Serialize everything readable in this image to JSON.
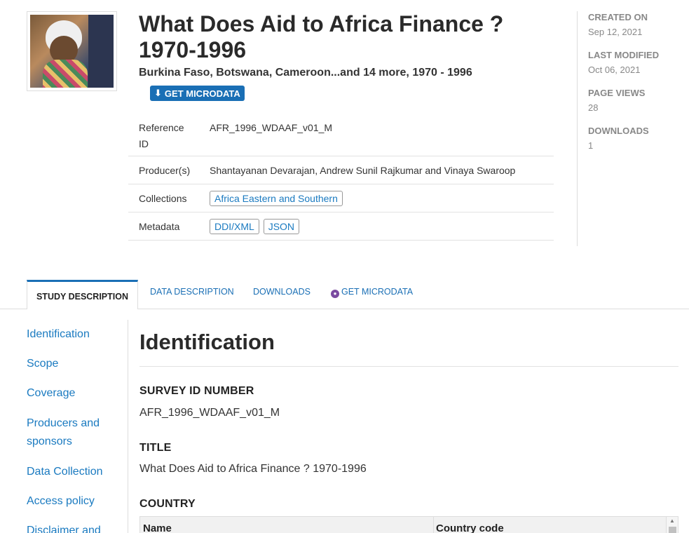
{
  "header": {
    "title": "What Does Aid to Africa Finance ? 1970-1996",
    "subtitle": "Burkina Faso, Botswana, Cameroon...and 14 more, 1970 - 1996",
    "get_microdata_label": "GET MICRODATA"
  },
  "meta": {
    "reference_id_label": "Reference ID",
    "reference_id": "AFR_1996_WDAAF_v01_M",
    "producers_label": "Producer(s)",
    "producers": "Shantayanan Devarajan, Andrew Sunil Rajkumar and Vinaya Swaroop",
    "collections_label": "Collections",
    "collection": "Africa Eastern and Southern",
    "metadata_label": "Metadata",
    "metadata_ddi": "DDI/XML",
    "metadata_json": "JSON"
  },
  "stats": {
    "created_on_label": "CREATED ON",
    "created_on": "Sep 12, 2021",
    "last_modified_label": "LAST MODIFIED",
    "last_modified": "Oct 06, 2021",
    "page_views_label": "PAGE VIEWS",
    "page_views": "28",
    "downloads_label": "DOWNLOADS",
    "downloads": "1"
  },
  "tabs": {
    "study": "STUDY DESCRIPTION",
    "data": "DATA DESCRIPTION",
    "downloads": "DOWNLOADS",
    "microdata": "GET MICRODATA"
  },
  "nav": {
    "identification": "Identification",
    "scope": "Scope",
    "coverage": "Coverage",
    "producers": "Producers and sponsors",
    "data_collection": "Data Collection",
    "access_policy": "Access policy",
    "disclaimer": "Disclaimer and"
  },
  "content": {
    "heading": "Identification",
    "survey_id_label": "SURVEY ID NUMBER",
    "survey_id": "AFR_1996_WDAAF_v01_M",
    "title_label": "TITLE",
    "title_value": "What Does Aid to Africa Finance ? 1970-1996",
    "country_label": "COUNTRY",
    "col_name": "Name",
    "col_code": "Country code"
  },
  "colors": {
    "accent": "#1a6fb5",
    "link": "#1a7ac0",
    "lock": "#7a4aa0"
  }
}
